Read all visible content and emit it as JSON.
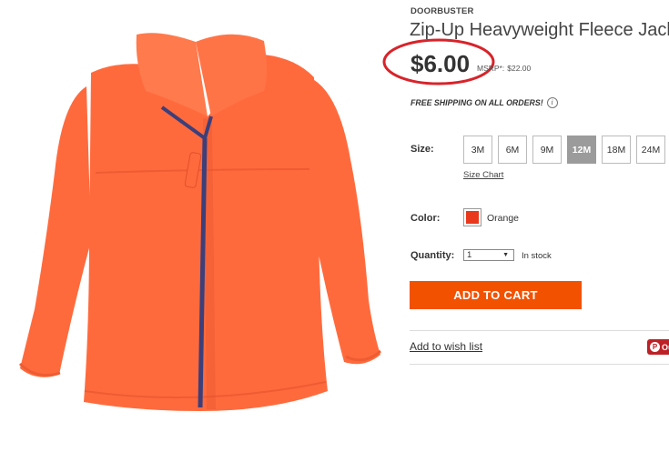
{
  "product": {
    "promo_label": "DOORBUSTER",
    "title": "Zip-Up Heavyweight Fleece Jack",
    "price": "$6.00",
    "msrp_label": "MSRP*:",
    "msrp_value": "$22.00",
    "shipping_text": "FREE SHIPPING ON ALL ORDERS!",
    "info_icon_glyph": "i",
    "image_icon": "orange-fleece-jacket-image",
    "colors": {
      "jacket": "#ff6a3d",
      "zipper": "#3c3f7a",
      "price_circle": "#d8232a",
      "cta": "#f25200"
    }
  },
  "size": {
    "label": "Size:",
    "options": [
      "3M",
      "6M",
      "9M",
      "12M",
      "18M",
      "24M"
    ],
    "selected": "12M",
    "chart_link": "Size Chart"
  },
  "color": {
    "label": "Color:",
    "name": "Orange",
    "swatch": "#e8391d"
  },
  "quantity": {
    "label": "Quantity:",
    "value": "1",
    "arrow_glyph": "▼",
    "stock": "In stock"
  },
  "actions": {
    "add_to_cart": "ADD TO CART",
    "wishlist": "Add to wish list",
    "pin_icon_glyph": "P",
    "pin_label": "Ou"
  }
}
